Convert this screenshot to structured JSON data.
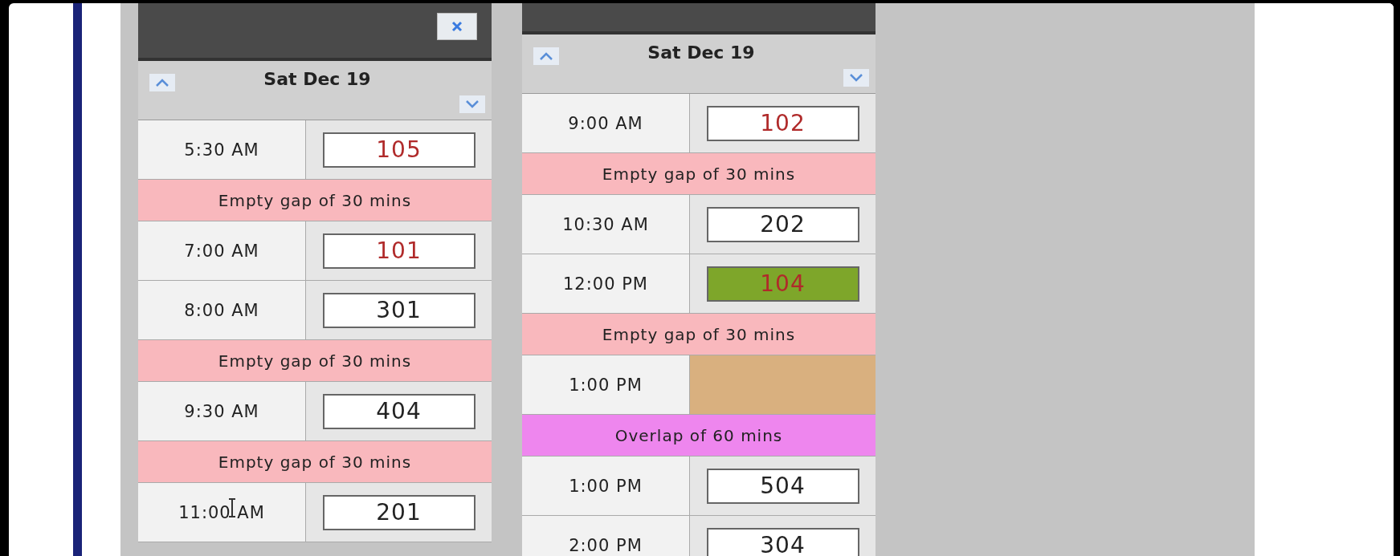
{
  "columns": [
    {
      "date": "Sat Dec 19",
      "closable": true,
      "rows": [
        {
          "kind": "slot",
          "time": "5:30 AM",
          "value": "105",
          "alert": true,
          "highlighted": false
        },
        {
          "kind": "gap",
          "text": "Empty gap of 30 mins"
        },
        {
          "kind": "slot",
          "time": "7:00 AM",
          "value": "101",
          "alert": true,
          "highlighted": false
        },
        {
          "kind": "slot",
          "time": "8:00 AM",
          "value": "301",
          "alert": false,
          "highlighted": false
        },
        {
          "kind": "gap",
          "text": "Empty gap of 30 mins"
        },
        {
          "kind": "slot",
          "time": "9:30 AM",
          "value": "404",
          "alert": false,
          "highlighted": false
        },
        {
          "kind": "gap",
          "text": "Empty gap of 30 mins"
        },
        {
          "kind": "slot",
          "time": "11:00 AM",
          "value": "201",
          "alert": false,
          "highlighted": false,
          "cursor": true
        }
      ]
    },
    {
      "date": "Sat Dec 19",
      "closable": false,
      "rows": [
        {
          "kind": "slot",
          "time": "9:00 AM",
          "value": "102",
          "alert": true,
          "highlighted": false
        },
        {
          "kind": "gap",
          "text": "Empty gap of 30 mins"
        },
        {
          "kind": "slot",
          "time": "10:30 AM",
          "value": "202",
          "alert": false,
          "highlighted": false
        },
        {
          "kind": "slot",
          "time": "12:00 PM",
          "value": "104",
          "alert": true,
          "highlighted": true
        },
        {
          "kind": "gap",
          "text": "Empty gap of 30 mins"
        },
        {
          "kind": "block",
          "time": "1:00 PM"
        },
        {
          "kind": "overlap",
          "text": "Overlap of 60 mins"
        },
        {
          "kind": "slot",
          "time": "1:00 PM",
          "value": "504",
          "alert": false,
          "highlighted": false
        },
        {
          "kind": "slot",
          "time": "2:00 PM",
          "value": "304",
          "alert": false,
          "highlighted": false
        }
      ]
    }
  ]
}
